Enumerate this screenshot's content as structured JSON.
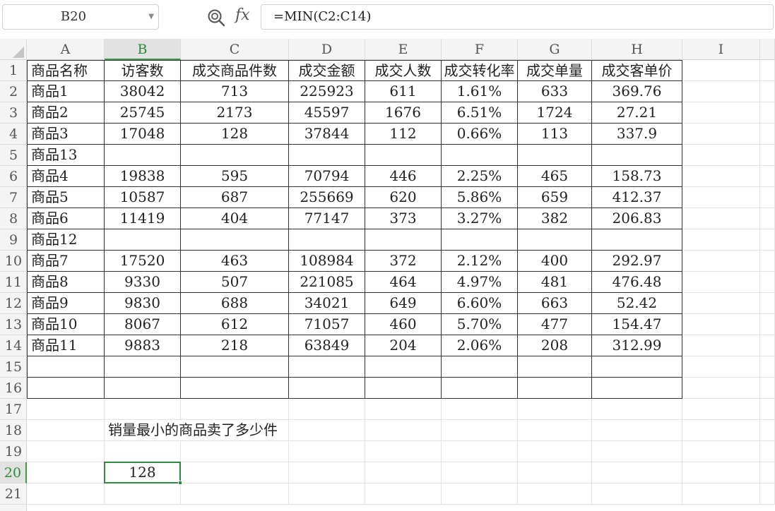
{
  "formula_bar": {
    "name_box": "B20",
    "fx_label": "fx",
    "formula": "=MIN(C2:C14)"
  },
  "columns": [
    "A",
    "B",
    "C",
    "D",
    "E",
    "F",
    "G",
    "H",
    "I"
  ],
  "active_column": "B",
  "active_row": "20",
  "rows": [
    "1",
    "2",
    "3",
    "4",
    "5",
    "6",
    "7",
    "8",
    "9",
    "10",
    "11",
    "12",
    "13",
    "14",
    "15",
    "16",
    "17",
    "18",
    "19",
    "20",
    "21"
  ],
  "table": {
    "headers": [
      "商品名称",
      "访客数",
      "成交商品件数",
      "成交金额",
      "成交人数",
      "成交转化率",
      "成交单量",
      "成交客单价"
    ],
    "rows": [
      [
        "商品1",
        "38042",
        "713",
        "225923",
        "611",
        "1.61%",
        "633",
        "369.76"
      ],
      [
        "商品2",
        "25745",
        "2173",
        "45597",
        "1676",
        "6.51%",
        "1724",
        "27.21"
      ],
      [
        "商品3",
        "17048",
        "128",
        "37844",
        "112",
        "0.66%",
        "113",
        "337.9"
      ],
      [
        "商品13",
        "",
        "",
        "",
        "",
        "",
        "",
        ""
      ],
      [
        "商品4",
        "19838",
        "595",
        "70794",
        "446",
        "2.25%",
        "465",
        "158.73"
      ],
      [
        "商品5",
        "10587",
        "687",
        "255669",
        "620",
        "5.86%",
        "659",
        "412.37"
      ],
      [
        "商品6",
        "11419",
        "404",
        "77147",
        "373",
        "3.27%",
        "382",
        "206.83"
      ],
      [
        "商品12",
        "",
        "",
        "",
        "",
        "",
        "",
        ""
      ],
      [
        "商品7",
        "17520",
        "463",
        "108984",
        "372",
        "2.12%",
        "400",
        "292.97"
      ],
      [
        "商品8",
        "9330",
        "507",
        "221085",
        "464",
        "4.97%",
        "481",
        "476.48"
      ],
      [
        "商品9",
        "9830",
        "688",
        "34021",
        "649",
        "6.60%",
        "663",
        "52.42"
      ],
      [
        "商品10",
        "8067",
        "612",
        "71057",
        "460",
        "5.70%",
        "477",
        "154.47"
      ],
      [
        "商品11",
        "9883",
        "218",
        "63849",
        "204",
        "2.06%",
        "208",
        "312.99"
      ],
      [
        "",
        "",
        "",
        "",
        "",
        "",
        "",
        ""
      ],
      [
        "",
        "",
        "",
        "",
        "",
        "",
        "",
        ""
      ]
    ]
  },
  "question": "销量最小的商品卖了多少件",
  "answer": "128",
  "icons": {
    "zoom": "zoom-lookup-icon",
    "dropdown": "chevron-down-icon",
    "select_all": "select-all-triangle-icon"
  },
  "colors": {
    "selection": "#2f8b3f",
    "active_header_text": "#2a8a3e"
  }
}
